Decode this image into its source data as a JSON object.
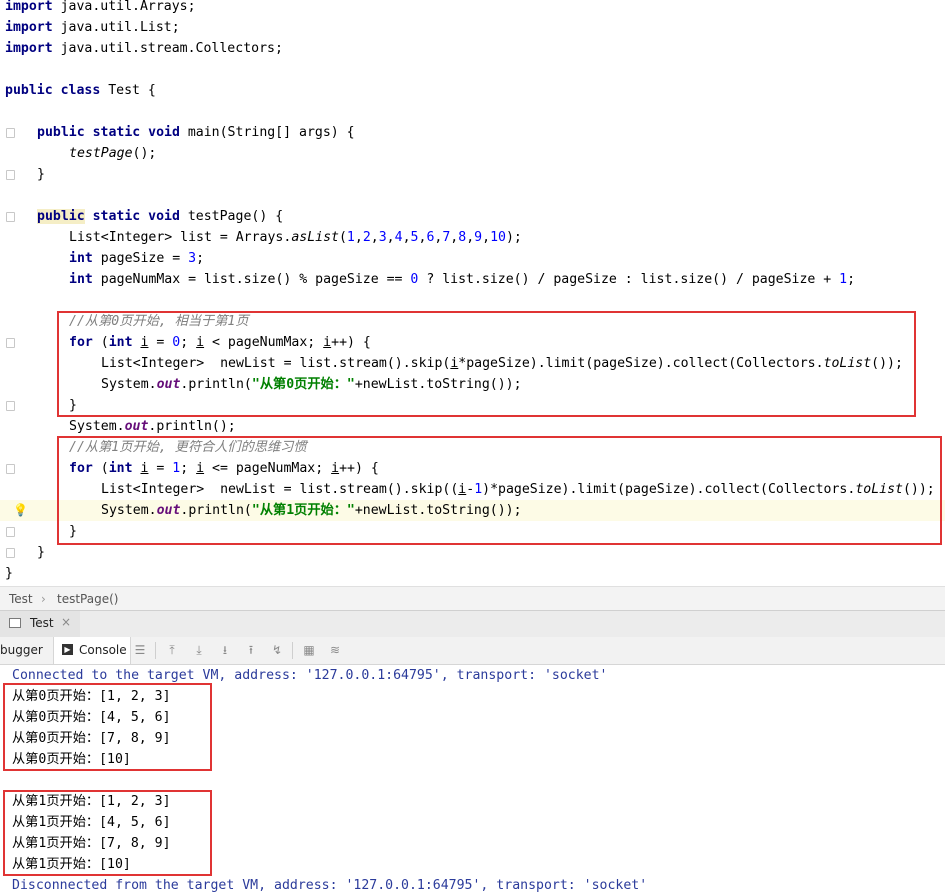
{
  "editor": {
    "lines": [
      [
        "import java.util.Arrays;"
      ],
      [
        "import java.util.List;"
      ],
      [
        "import java.util.stream.Collectors;"
      ],
      [
        ""
      ],
      [
        "public class Test {"
      ],
      [
        ""
      ],
      [
        "    public static void main(String[] args) {"
      ],
      [
        "        testPage();"
      ],
      [
        "    }"
      ],
      [
        ""
      ],
      [
        "    public static void testPage() {"
      ],
      [
        "        List<Integer> list = Arrays.asList(1,2,3,4,5,6,7,8,9,10);"
      ],
      [
        "        int pageSize = 3;"
      ],
      [
        "        int pageNumMax = list.size() % pageSize == 0 ? list.size() / pageSize : list.size() / pageSize + 1;"
      ],
      [
        ""
      ],
      [
        "        //从第0页开始, 相当于第1页"
      ],
      [
        "        for (int i = 0; i < pageNumMax; i++) {"
      ],
      [
        "            List<Integer>  newList = list.stream().skip(i*pageSize).limit(pageSize).collect(Collectors.toList());"
      ],
      [
        "            System.out.println(\"从第0页开始：\"+newList.toString());"
      ],
      [
        "        }"
      ],
      [
        "        System.out.println();"
      ],
      [
        "        //从第1页开始, 更符合人们的思维习惯"
      ],
      [
        "        for (int i = 1; i <= pageNumMax; i++) {"
      ],
      [
        "            List<Integer>  newList = list.stream().skip((i-1)*pageSize).limit(pageSize).collect(Collectors.toList());"
      ],
      [
        "            System.out.println(\"从第1页开始：\"+newList.toString());"
      ],
      [
        "        }"
      ],
      [
        "    }"
      ],
      [
        "}"
      ]
    ]
  },
  "breadcrumb": {
    "class": "Test",
    "separator": "›",
    "method": "testPage()"
  },
  "run_tab": {
    "label": "Test",
    "close": "×"
  },
  "toolbar": {
    "debugger_tab": "bugger",
    "console_tab": "Console"
  },
  "console": {
    "connected": "Connected to the target VM, address: '127.0.0.1:64795', transport: 'socket'",
    "output0": [
      "从第0页开始：[1, 2, 3]",
      "从第0页开始：[4, 5, 6]",
      "从第0页开始：[7, 8, 9]",
      "从第0页开始：[10]"
    ],
    "output1": [
      "从第1页开始：[1, 2, 3]",
      "从第1页开始：[4, 5, 6]",
      "从第1页开始：[7, 8, 9]",
      "从第1页开始：[10]"
    ],
    "disconnected": "Disconnected from the target VM, address: '127.0.0.1:64795', transport: 'socket'"
  },
  "colors": {
    "keyword": "#000080",
    "string": "#008000",
    "comment": "#808080",
    "field": "#660e7a",
    "highlight_box": "#e03434"
  }
}
